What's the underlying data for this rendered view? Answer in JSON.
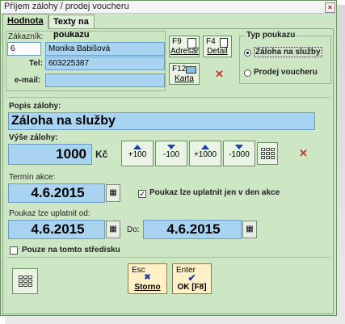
{
  "window": {
    "title": "Příjem zálohy / prodej voucheru",
    "close_glyph": "×"
  },
  "tabs": [
    {
      "label": "Hodnota"
    },
    {
      "label": "Texty na poukazu"
    }
  ],
  "customer": {
    "label": "Zákazník:",
    "id_value": "6",
    "name_value": "Monika Babišová",
    "tel_label": "Tel:",
    "tel_value": "603225387",
    "email_label": "e-mail:",
    "email_value": ""
  },
  "buttons": {
    "adresar_key": "F9",
    "adresar_label": "Adresář",
    "detail_key": "F4",
    "detail_label": "Detail",
    "karta_key": "F12",
    "karta_label": "Karta",
    "clear_glyph": "✕"
  },
  "voucher_type": {
    "label": "Typ poukazu",
    "options": [
      {
        "label": "Záloha na služby",
        "selected": true
      },
      {
        "label": "Prodej voucheru",
        "selected": false
      }
    ]
  },
  "description": {
    "label": "Popis zálohy:",
    "value": "Záloha na služby"
  },
  "amount": {
    "label": "Výše zálohy:",
    "value": "1000",
    "currency": "Kč",
    "steps": [
      {
        "label": "+100",
        "dir": "up"
      },
      {
        "label": "-100",
        "dir": "down"
      },
      {
        "label": "+1000",
        "dir": "up"
      },
      {
        "label": "-1000",
        "dir": "down"
      }
    ]
  },
  "event": {
    "label": "Termín akce:",
    "date": "4.6.2015",
    "checkbox_label": "Poukaz lze uplatnit jen v den akce",
    "checked": true
  },
  "validity": {
    "label": "Poukaz lze uplatnit od:",
    "from": "4.6.2015",
    "to_label": "Do:",
    "to": "4.6.2015"
  },
  "branch_only": {
    "label": "Pouze na tomto středisku",
    "checked": false
  },
  "footer": {
    "storno_key": "Esc",
    "storno_label": "Storno",
    "ok_key": "Enter",
    "ok_label": "OK [F8]"
  }
}
